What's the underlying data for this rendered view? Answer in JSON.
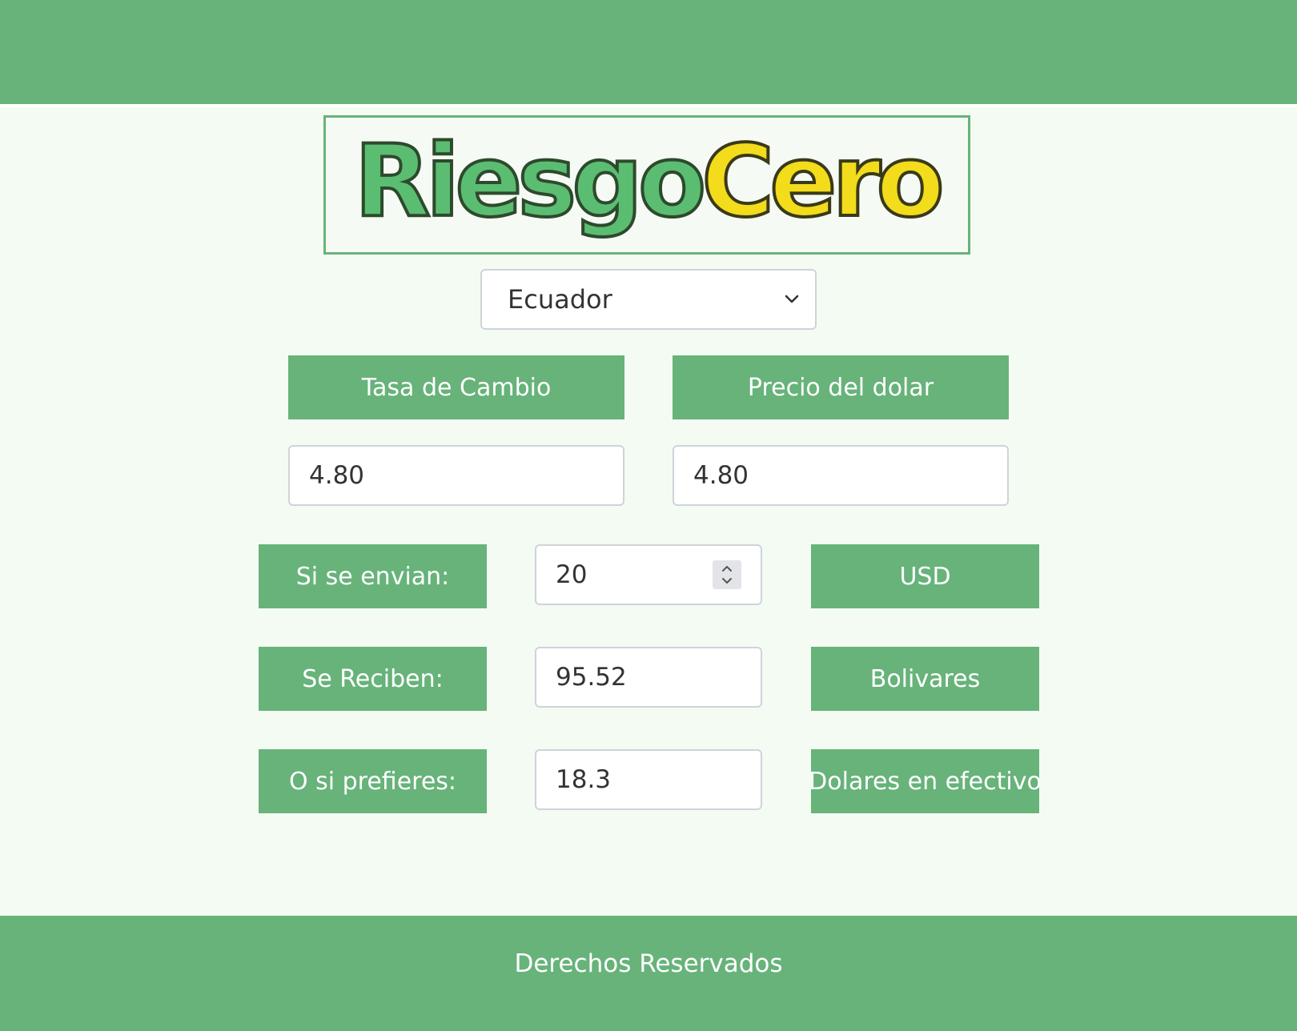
{
  "brand": {
    "logo": {
      "part1": "Riesgo",
      "part2": "Cero"
    }
  },
  "country_select": {
    "selected": "Ecuador"
  },
  "rates": {
    "tasa_label": "Tasa de Cambio",
    "precio_label": "Precio del dolar",
    "tasa_value": "4.80",
    "precio_value": "4.80"
  },
  "calculator": {
    "send_label": "Si se envian:",
    "send_value": "20",
    "send_currency": "USD",
    "receive_label": "Se Reciben:",
    "receive_value": "95.52",
    "receive_currency": "Bolivares",
    "alt_label": "O si prefieres:",
    "alt_value": "18.3",
    "alt_currency": "Dolares en efectivo"
  },
  "footer": {
    "text": "Derechos Reservados"
  },
  "colors": {
    "primary_green": "#67b37a",
    "background": "#f4fbf3",
    "logo_green": "#5bbd72",
    "logo_yellow": "#f2dc1b"
  },
  "icons": {
    "select_arrow": "chevron-down-icon",
    "number_stepper": "spinner-icon"
  }
}
